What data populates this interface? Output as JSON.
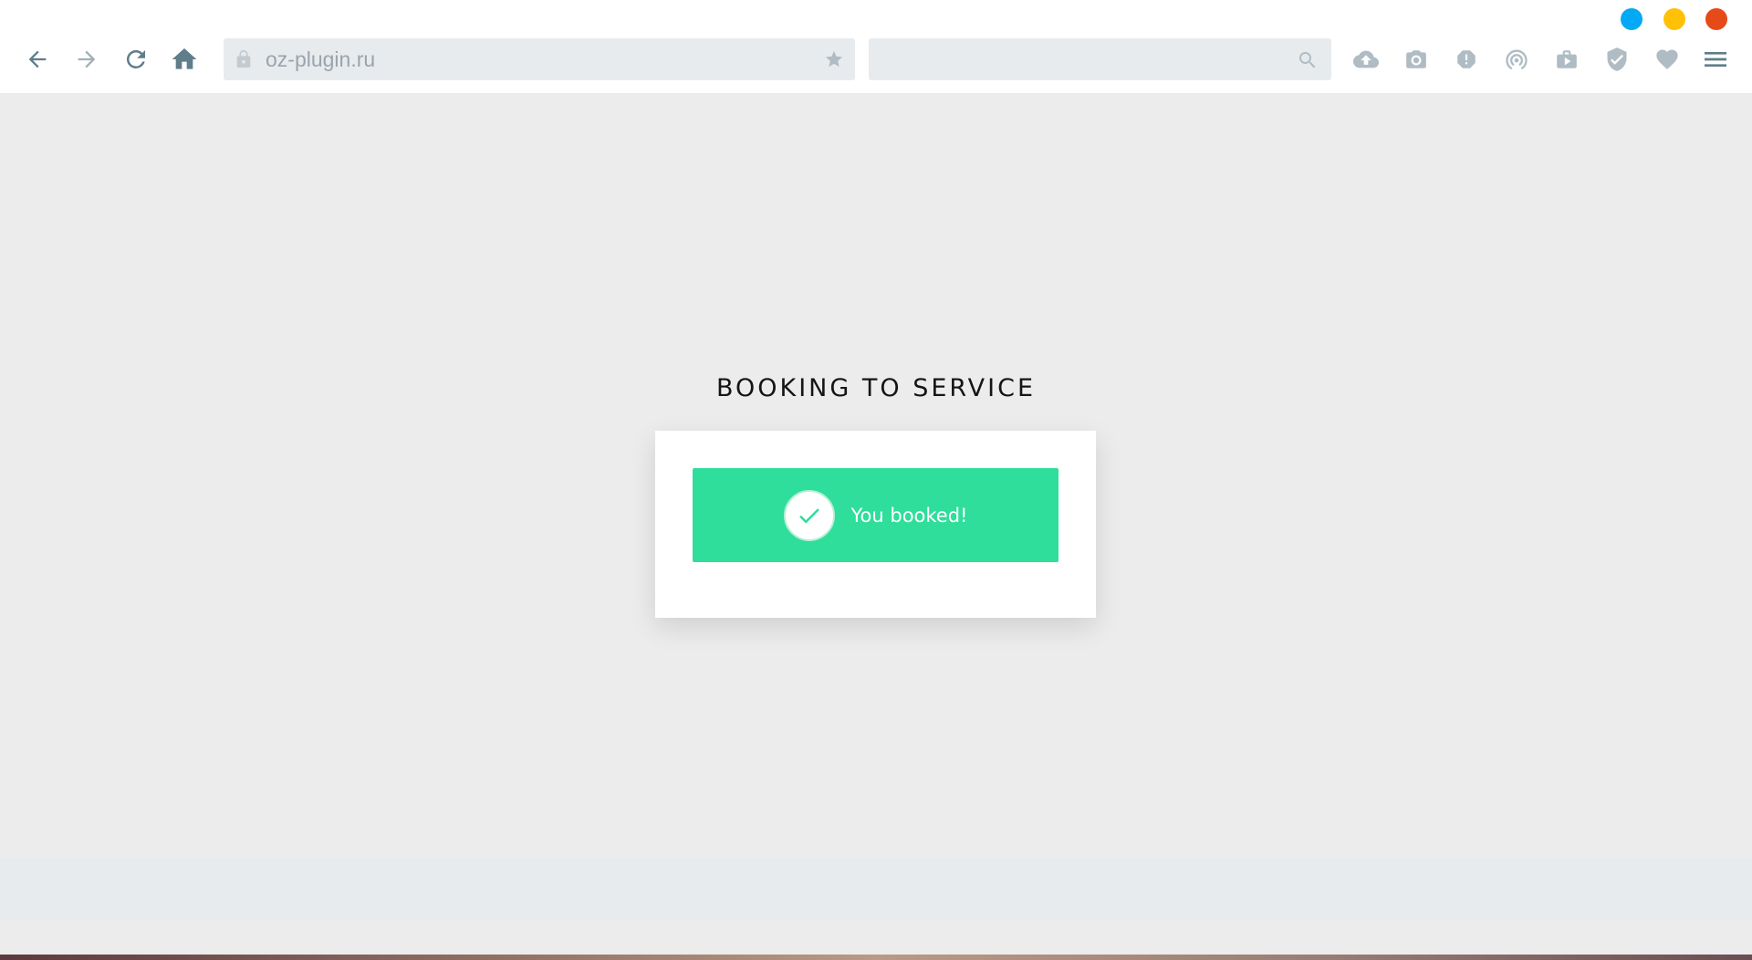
{
  "browser": {
    "url": "oz-plugin.ru",
    "search_value": "",
    "window_controls": [
      {
        "name": "minimize",
        "color": "#03a9f4"
      },
      {
        "name": "maximize",
        "color": "#ffc107"
      },
      {
        "name": "close",
        "color": "#e64a19"
      }
    ],
    "nav_icons": [
      "back-arrow-icon",
      "forward-arrow-icon",
      "reload-icon",
      "home-icon"
    ],
    "toolbar_icons": [
      "cloud-upload-icon",
      "camera-icon",
      "alert-icon",
      "wifi-tethering-icon",
      "video-briefcase-icon",
      "shield-check-icon",
      "heart-icon",
      "menu-icon"
    ],
    "icon_color": "#b0bcc4",
    "nav_icon_color": "#607d8b"
  },
  "page": {
    "title": "BOOKING TO SERVICE",
    "success": {
      "message": "You booked!",
      "icon": "checkmark-icon",
      "background": "#2ede9a"
    }
  }
}
